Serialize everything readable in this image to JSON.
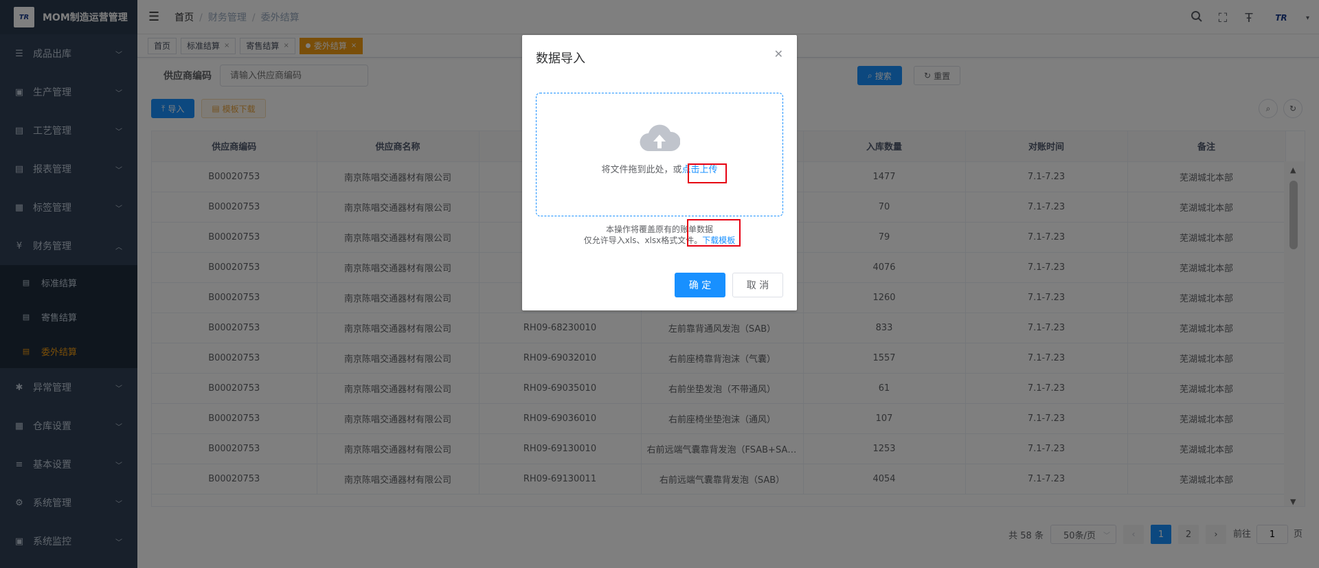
{
  "app": {
    "title": "MOM制造运营管理",
    "logo_text": "TR"
  },
  "sidebar": {
    "items": [
      {
        "label": "成品出库",
        "icon": "list-icon"
      },
      {
        "label": "生产管理",
        "icon": "monitor-icon"
      },
      {
        "label": "工艺管理",
        "icon": "form-icon"
      },
      {
        "label": "报表管理",
        "icon": "form-icon"
      },
      {
        "label": "标签管理",
        "icon": "grid-icon"
      },
      {
        "label": "财务管理",
        "icon": "yen-icon"
      },
      {
        "label": "异常管理",
        "icon": "bug-icon"
      },
      {
        "label": "仓库设置",
        "icon": "grid-icon"
      },
      {
        "label": "基本设置",
        "icon": "sliders-icon"
      },
      {
        "label": "系统管理",
        "icon": "gear-icon"
      },
      {
        "label": "系统监控",
        "icon": "monitor-icon"
      }
    ],
    "finance_sub": [
      {
        "label": "标准结算"
      },
      {
        "label": "寄售结算"
      },
      {
        "label": "委外结算"
      }
    ]
  },
  "breadcrumb": {
    "home": "首页",
    "parent": "财务管理",
    "current": "委外结算"
  },
  "tags": [
    {
      "label": "首页"
    },
    {
      "label": "标准结算"
    },
    {
      "label": "寄售结算"
    },
    {
      "label": "委外结算"
    }
  ],
  "search": {
    "label": "供应商编码",
    "placeholder": "请输入供应商编码",
    "search_btn": "搜索",
    "reset_btn": "重置"
  },
  "toolbar": {
    "import_btn": "导入",
    "template_btn": "模板下载"
  },
  "table": {
    "headers": [
      "供应商编码",
      "供应商名称",
      "",
      "",
      "入库数量",
      "对账时间",
      "备注"
    ],
    "rows": [
      [
        "B00020753",
        "南京陈唱交通器材有限公司",
        "",
        "",
        "1477",
        "7.1-7.23",
        "芜湖城北本部"
      ],
      [
        "B00020753",
        "南京陈唱交通器材有限公司",
        "",
        "",
        "70",
        "7.1-7.23",
        "芜湖城北本部"
      ],
      [
        "B00020753",
        "南京陈唱交通器材有限公司",
        "",
        "",
        "79",
        "7.1-7.23",
        "芜湖城北本部"
      ],
      [
        "B00020753",
        "南京陈唱交通器材有限公司",
        "",
        "",
        "4076",
        "7.1-7.23",
        "芜湖城北本部"
      ],
      [
        "B00020753",
        "南京陈唱交通器材有限公司",
        "",
        "",
        "1260",
        "7.1-7.23",
        "芜湖城北本部"
      ],
      [
        "B00020753",
        "南京陈唱交通器材有限公司",
        "RH09-68230010",
        "左前靠背通风发泡（SAB）",
        "833",
        "7.1-7.23",
        "芜湖城北本部"
      ],
      [
        "B00020753",
        "南京陈唱交通器材有限公司",
        "RH09-69032010",
        "右前座椅靠背泡沫（气囊）",
        "1557",
        "7.1-7.23",
        "芜湖城北本部"
      ],
      [
        "B00020753",
        "南京陈唱交通器材有限公司",
        "RH09-69035010",
        "右前坐垫发泡（不带通风）",
        "61",
        "7.1-7.23",
        "芜湖城北本部"
      ],
      [
        "B00020753",
        "南京陈唱交通器材有限公司",
        "RH09-69036010",
        "右前座椅坐垫泡沫（通风）",
        "107",
        "7.1-7.23",
        "芜湖城北本部"
      ],
      [
        "B00020753",
        "南京陈唱交通器材有限公司",
        "RH09-69130010",
        "右前远端气囊靠背发泡（FSAB+SAB）",
        "1253",
        "7.1-7.23",
        "芜湖城北本部"
      ],
      [
        "B00020753",
        "南京陈唱交通器材有限公司",
        "RH09-69130011",
        "右前远端气囊靠背发泡（SAB）",
        "4054",
        "7.1-7.23",
        "芜湖城北本部"
      ]
    ]
  },
  "pagination": {
    "total": "共 58 条",
    "page_size": "50条/页",
    "pages": [
      "1",
      "2"
    ],
    "goto_label": "前往",
    "goto_value": "1",
    "page_suffix": "页"
  },
  "dialog": {
    "title": "数据导入",
    "drop_text": "将文件拖到此处，或",
    "click_upload": "点击上传",
    "tip1": "本操作将覆盖原有的账单数据",
    "tip2": "仅允许导入xls、xlsx格式文件。",
    "download_link": "下载模板",
    "ok": "确 定",
    "cancel": "取 消"
  }
}
